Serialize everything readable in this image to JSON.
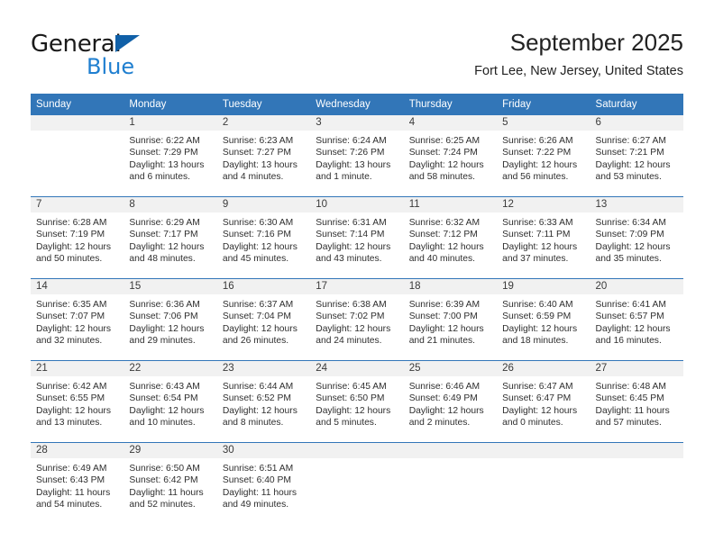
{
  "brand": {
    "name_top": "General",
    "name_bottom": "Blue",
    "triangle_color": "#1060a8",
    "blue_text_color": "#1f7fd0"
  },
  "header": {
    "title": "September 2025",
    "subtitle": "Fort Lee, New Jersey, United States"
  },
  "colors": {
    "header_blue": "#3276b8",
    "daynum_band": "#f1f1f1",
    "text": "#2e2e2e"
  },
  "weekdays": [
    "Sunday",
    "Monday",
    "Tuesday",
    "Wednesday",
    "Thursday",
    "Friday",
    "Saturday"
  ],
  "weeks": [
    [
      {
        "day": "",
        "sunrise": "",
        "sunset": "",
        "daylight_a": "",
        "daylight_b": ""
      },
      {
        "day": "1",
        "sunrise": "Sunrise: 6:22 AM",
        "sunset": "Sunset: 7:29 PM",
        "daylight_a": "Daylight: 13 hours",
        "daylight_b": "and 6 minutes."
      },
      {
        "day": "2",
        "sunrise": "Sunrise: 6:23 AM",
        "sunset": "Sunset: 7:27 PM",
        "daylight_a": "Daylight: 13 hours",
        "daylight_b": "and 4 minutes."
      },
      {
        "day": "3",
        "sunrise": "Sunrise: 6:24 AM",
        "sunset": "Sunset: 7:26 PM",
        "daylight_a": "Daylight: 13 hours",
        "daylight_b": "and 1 minute."
      },
      {
        "day": "4",
        "sunrise": "Sunrise: 6:25 AM",
        "sunset": "Sunset: 7:24 PM",
        "daylight_a": "Daylight: 12 hours",
        "daylight_b": "and 58 minutes."
      },
      {
        "day": "5",
        "sunrise": "Sunrise: 6:26 AM",
        "sunset": "Sunset: 7:22 PM",
        "daylight_a": "Daylight: 12 hours",
        "daylight_b": "and 56 minutes."
      },
      {
        "day": "6",
        "sunrise": "Sunrise: 6:27 AM",
        "sunset": "Sunset: 7:21 PM",
        "daylight_a": "Daylight: 12 hours",
        "daylight_b": "and 53 minutes."
      }
    ],
    [
      {
        "day": "7",
        "sunrise": "Sunrise: 6:28 AM",
        "sunset": "Sunset: 7:19 PM",
        "daylight_a": "Daylight: 12 hours",
        "daylight_b": "and 50 minutes."
      },
      {
        "day": "8",
        "sunrise": "Sunrise: 6:29 AM",
        "sunset": "Sunset: 7:17 PM",
        "daylight_a": "Daylight: 12 hours",
        "daylight_b": "and 48 minutes."
      },
      {
        "day": "9",
        "sunrise": "Sunrise: 6:30 AM",
        "sunset": "Sunset: 7:16 PM",
        "daylight_a": "Daylight: 12 hours",
        "daylight_b": "and 45 minutes."
      },
      {
        "day": "10",
        "sunrise": "Sunrise: 6:31 AM",
        "sunset": "Sunset: 7:14 PM",
        "daylight_a": "Daylight: 12 hours",
        "daylight_b": "and 43 minutes."
      },
      {
        "day": "11",
        "sunrise": "Sunrise: 6:32 AM",
        "sunset": "Sunset: 7:12 PM",
        "daylight_a": "Daylight: 12 hours",
        "daylight_b": "and 40 minutes."
      },
      {
        "day": "12",
        "sunrise": "Sunrise: 6:33 AM",
        "sunset": "Sunset: 7:11 PM",
        "daylight_a": "Daylight: 12 hours",
        "daylight_b": "and 37 minutes."
      },
      {
        "day": "13",
        "sunrise": "Sunrise: 6:34 AM",
        "sunset": "Sunset: 7:09 PM",
        "daylight_a": "Daylight: 12 hours",
        "daylight_b": "and 35 minutes."
      }
    ],
    [
      {
        "day": "14",
        "sunrise": "Sunrise: 6:35 AM",
        "sunset": "Sunset: 7:07 PM",
        "daylight_a": "Daylight: 12 hours",
        "daylight_b": "and 32 minutes."
      },
      {
        "day": "15",
        "sunrise": "Sunrise: 6:36 AM",
        "sunset": "Sunset: 7:06 PM",
        "daylight_a": "Daylight: 12 hours",
        "daylight_b": "and 29 minutes."
      },
      {
        "day": "16",
        "sunrise": "Sunrise: 6:37 AM",
        "sunset": "Sunset: 7:04 PM",
        "daylight_a": "Daylight: 12 hours",
        "daylight_b": "and 26 minutes."
      },
      {
        "day": "17",
        "sunrise": "Sunrise: 6:38 AM",
        "sunset": "Sunset: 7:02 PM",
        "daylight_a": "Daylight: 12 hours",
        "daylight_b": "and 24 minutes."
      },
      {
        "day": "18",
        "sunrise": "Sunrise: 6:39 AM",
        "sunset": "Sunset: 7:00 PM",
        "daylight_a": "Daylight: 12 hours",
        "daylight_b": "and 21 minutes."
      },
      {
        "day": "19",
        "sunrise": "Sunrise: 6:40 AM",
        "sunset": "Sunset: 6:59 PM",
        "daylight_a": "Daylight: 12 hours",
        "daylight_b": "and 18 minutes."
      },
      {
        "day": "20",
        "sunrise": "Sunrise: 6:41 AM",
        "sunset": "Sunset: 6:57 PM",
        "daylight_a": "Daylight: 12 hours",
        "daylight_b": "and 16 minutes."
      }
    ],
    [
      {
        "day": "21",
        "sunrise": "Sunrise: 6:42 AM",
        "sunset": "Sunset: 6:55 PM",
        "daylight_a": "Daylight: 12 hours",
        "daylight_b": "and 13 minutes."
      },
      {
        "day": "22",
        "sunrise": "Sunrise: 6:43 AM",
        "sunset": "Sunset: 6:54 PM",
        "daylight_a": "Daylight: 12 hours",
        "daylight_b": "and 10 minutes."
      },
      {
        "day": "23",
        "sunrise": "Sunrise: 6:44 AM",
        "sunset": "Sunset: 6:52 PM",
        "daylight_a": "Daylight: 12 hours",
        "daylight_b": "and 8 minutes."
      },
      {
        "day": "24",
        "sunrise": "Sunrise: 6:45 AM",
        "sunset": "Sunset: 6:50 PM",
        "daylight_a": "Daylight: 12 hours",
        "daylight_b": "and 5 minutes."
      },
      {
        "day": "25",
        "sunrise": "Sunrise: 6:46 AM",
        "sunset": "Sunset: 6:49 PM",
        "daylight_a": "Daylight: 12 hours",
        "daylight_b": "and 2 minutes."
      },
      {
        "day": "26",
        "sunrise": "Sunrise: 6:47 AM",
        "sunset": "Sunset: 6:47 PM",
        "daylight_a": "Daylight: 12 hours",
        "daylight_b": "and 0 minutes."
      },
      {
        "day": "27",
        "sunrise": "Sunrise: 6:48 AM",
        "sunset": "Sunset: 6:45 PM",
        "daylight_a": "Daylight: 11 hours",
        "daylight_b": "and 57 minutes."
      }
    ],
    [
      {
        "day": "28",
        "sunrise": "Sunrise: 6:49 AM",
        "sunset": "Sunset: 6:43 PM",
        "daylight_a": "Daylight: 11 hours",
        "daylight_b": "and 54 minutes."
      },
      {
        "day": "29",
        "sunrise": "Sunrise: 6:50 AM",
        "sunset": "Sunset: 6:42 PM",
        "daylight_a": "Daylight: 11 hours",
        "daylight_b": "and 52 minutes."
      },
      {
        "day": "30",
        "sunrise": "Sunrise: 6:51 AM",
        "sunset": "Sunset: 6:40 PM",
        "daylight_a": "Daylight: 11 hours",
        "daylight_b": "and 49 minutes."
      },
      {
        "day": "",
        "sunrise": "",
        "sunset": "",
        "daylight_a": "",
        "daylight_b": ""
      },
      {
        "day": "",
        "sunrise": "",
        "sunset": "",
        "daylight_a": "",
        "daylight_b": ""
      },
      {
        "day": "",
        "sunrise": "",
        "sunset": "",
        "daylight_a": "",
        "daylight_b": ""
      },
      {
        "day": "",
        "sunrise": "",
        "sunset": "",
        "daylight_a": "",
        "daylight_b": ""
      }
    ]
  ]
}
